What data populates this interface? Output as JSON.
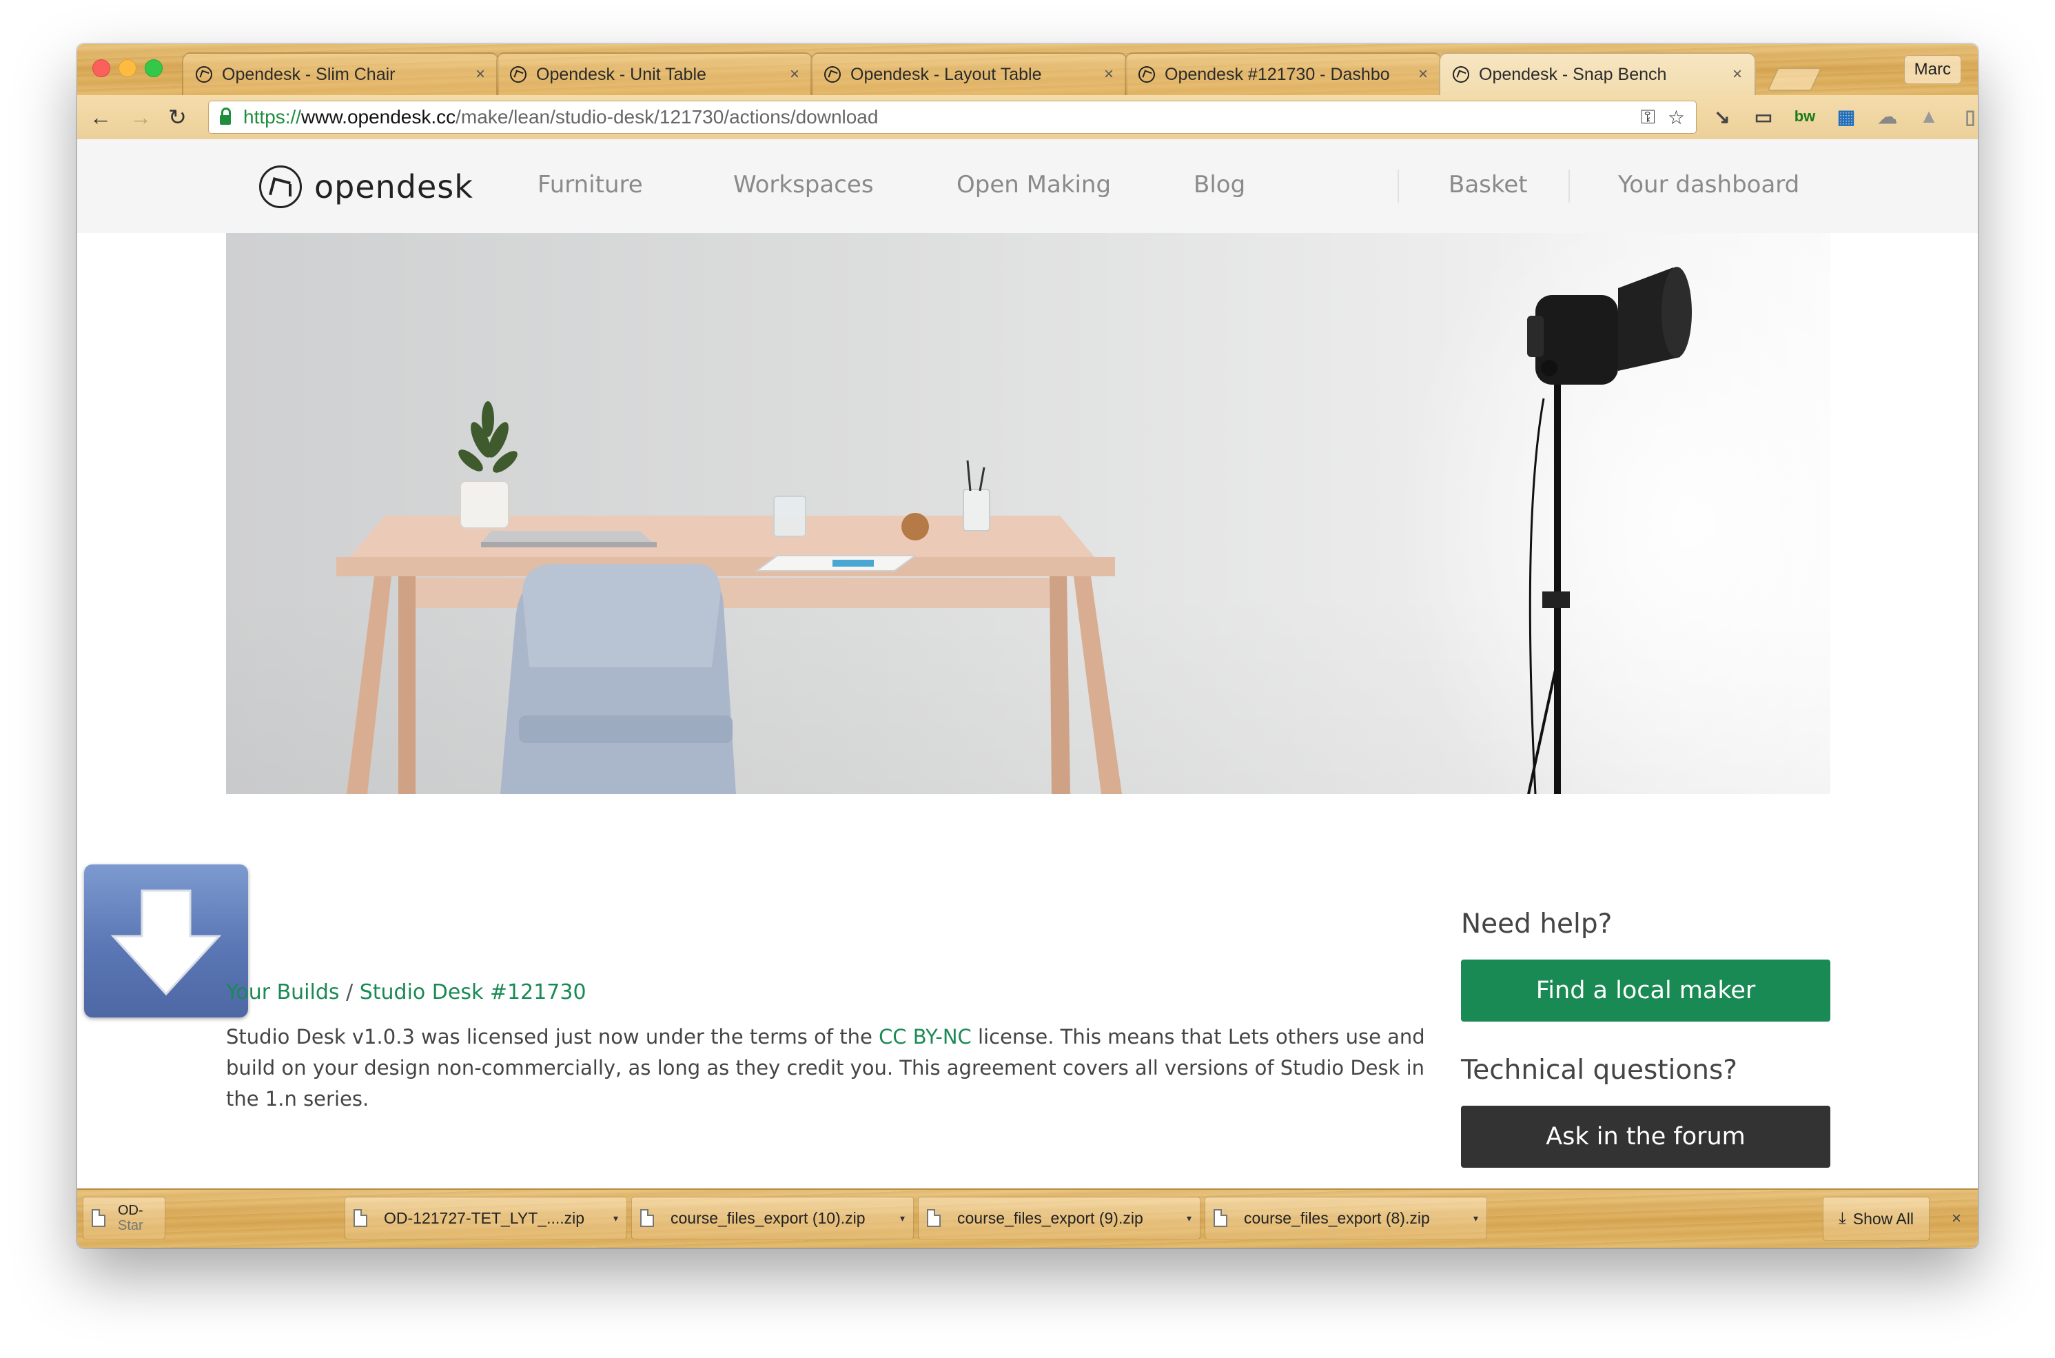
{
  "browser": {
    "tabs": [
      {
        "title": "Opendesk - Slim Chair",
        "close": "×"
      },
      {
        "title": "Opendesk - Unit Table",
        "close": "×"
      },
      {
        "title": "Opendesk - Layout Table",
        "close": "×"
      },
      {
        "title": "Opendesk #121730 - Dashbo",
        "close": "×"
      },
      {
        "title": "Opendesk - Snap Bench",
        "close": "×"
      }
    ],
    "profile": "Marc",
    "url": {
      "scheme": "https://",
      "host": "www.opendesk.cc",
      "path": "/make/lean/studio-desk/121730/actions/download"
    },
    "nav": {
      "back": "←",
      "forward": "→",
      "reload": "↻"
    },
    "omni_icons": {
      "key": "⚿",
      "star": "☆"
    },
    "extensions": [
      "↘",
      "▭",
      "bw",
      "▦",
      "☁",
      "▲",
      "▯",
      "◪",
      "⋮"
    ]
  },
  "site": {
    "logo_text": "opendesk",
    "nav": {
      "furniture": "Furniture",
      "workspaces": "Workspaces",
      "open_making": "Open Making",
      "blog": "Blog",
      "basket": "Basket",
      "dashboard": "Your dashboard"
    }
  },
  "content": {
    "breadcrumb": {
      "root": "Your Builds",
      "sep": " / ",
      "current": "Studio Desk #121730"
    },
    "license": {
      "part1": "Studio Desk v1.0.3 was licensed just now under the terms of the ",
      "link": "CC BY-NC",
      "part2": " license. This means that Lets others use and build on your design non-commercially, as long as they credit you. This agreement covers all versions of Studio Desk in the 1.n series."
    }
  },
  "sidebar": {
    "need_help": "Need help?",
    "find_maker": "Find a local maker",
    "tech_questions": "Technical questions?",
    "ask_forum": "Ask in the forum"
  },
  "downloads": {
    "partial": {
      "line1": "OD-",
      "line2": "Star"
    },
    "items": [
      {
        "name": "OD-121727-TET_LYT_....zip"
      },
      {
        "name": "course_files_export (10).zip"
      },
      {
        "name": "course_files_export (9).zip"
      },
      {
        "name": "course_files_export (8).zip"
      }
    ],
    "show_all": "Show All",
    "close": "×"
  },
  "colors": {
    "accent_green": "#1a8a55",
    "dark_button": "#333333"
  }
}
